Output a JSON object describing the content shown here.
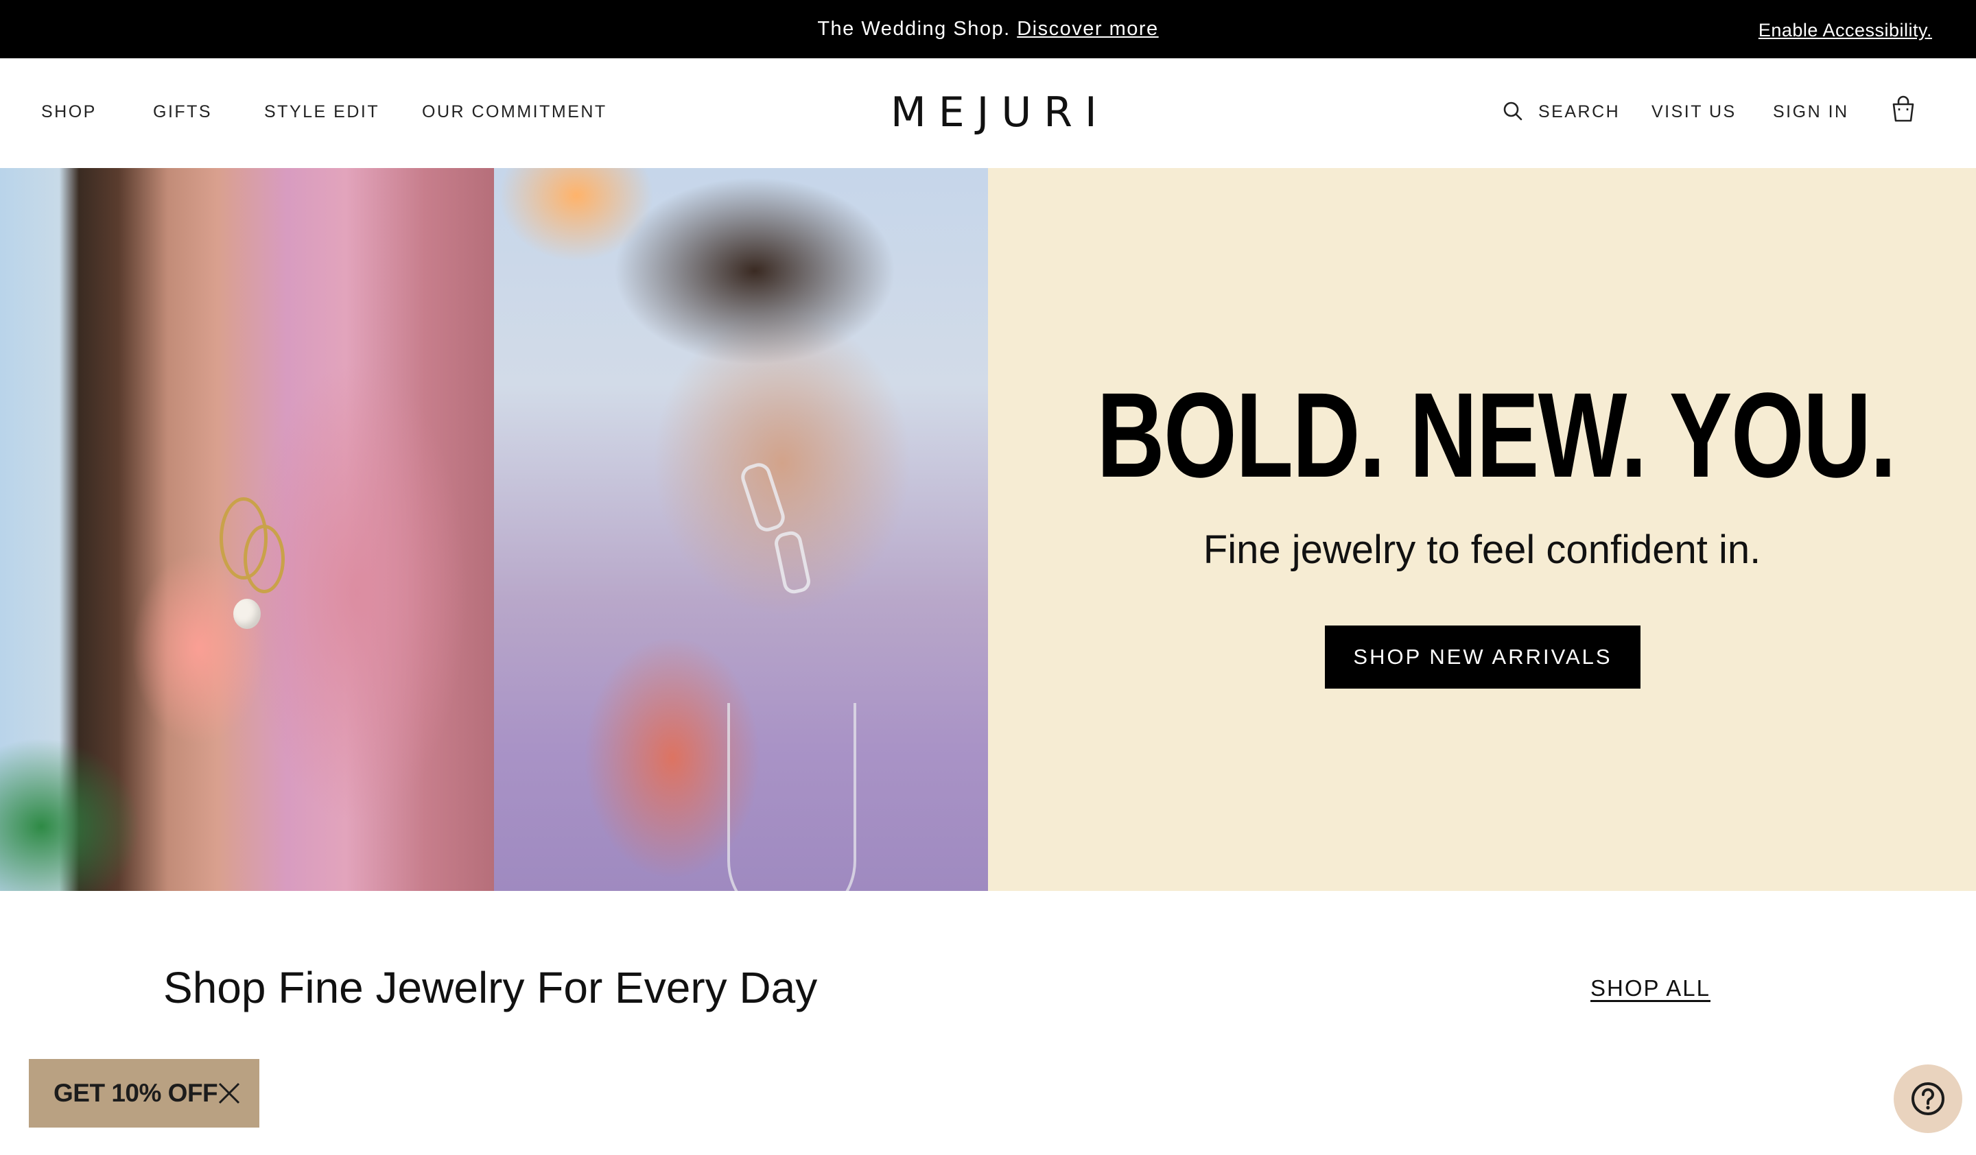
{
  "announcement": {
    "text": "The Wedding Shop.",
    "link": "Discover more",
    "accessibility": "Enable Accessibility."
  },
  "nav": {
    "left": [
      "SHOP",
      "GIFTS",
      "STYLE EDIT",
      "OUR COMMITMENT"
    ],
    "logo": "MEJURI",
    "search": "SEARCH",
    "visit": "VISIT US",
    "sign_in": "SIGN IN",
    "icons": {
      "search": "search-icon",
      "bag": "shopping-bag-icon"
    }
  },
  "hero": {
    "headline": "BOLD. NEW. YOU.",
    "subhead": "Fine jewelry to feel confident in.",
    "cta": "SHOP NEW ARRIVALS",
    "background": "#f6ecd3"
  },
  "section": {
    "title": "Shop Fine Jewelry For Every Day",
    "link": "SHOP ALL"
  },
  "promo_tab": {
    "label": "GET 10% OFF",
    "color": "#b9a182",
    "icon": "close-icon"
  },
  "help": {
    "icon": "question-circle-icon",
    "color": "#e9d3be"
  }
}
